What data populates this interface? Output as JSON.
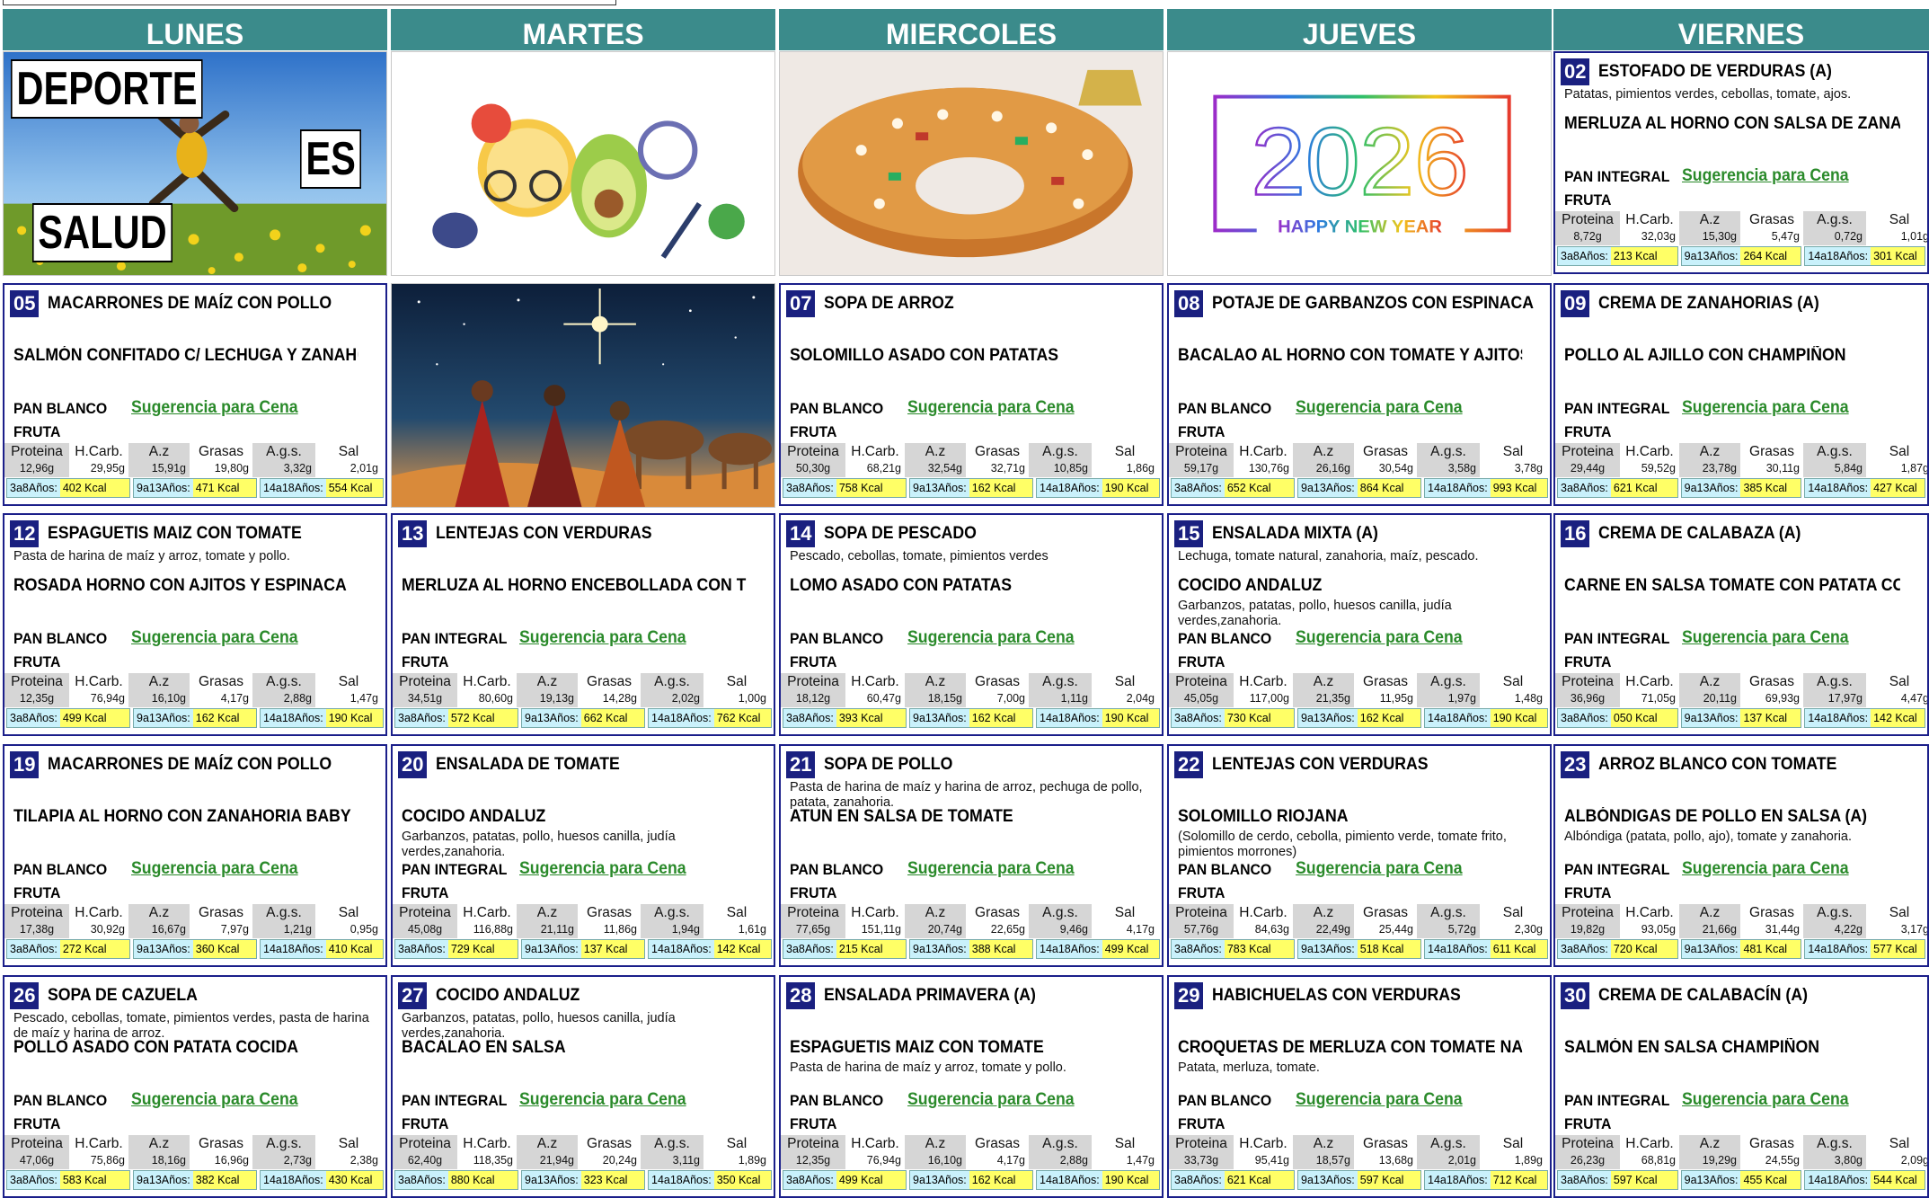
{
  "days": [
    "LUNES",
    "MARTES",
    "MIERCOLES",
    "JUEVES",
    "VIERNES"
  ],
  "image_cells": {
    "deporte": {
      "line1": "DEPORTE",
      "line2": "ES",
      "line3": "SALUD"
    },
    "newyear": {
      "year": "2026",
      "caption": "HAPPY NEW YEAR"
    }
  },
  "labels": {
    "sugerencia": "Sugerencia para Cena",
    "fruta": "FRUTA",
    "nutrients": [
      "Proteina",
      "H.Carb.",
      "A.z",
      "Grasas",
      "A.g.s.",
      "Sal"
    ],
    "age_groups": [
      "3a8Años:",
      "9a13Años:",
      "14a18Años:"
    ]
  },
  "cells": [
    {
      "day": "02",
      "dish1": "ESTOFADO DE VERDURAS (A)",
      "desc1": "Patatas, pimientos verdes, cebollas, tomate, ajos.",
      "dish2": "MERLUZA AL HORNO CON SALSA DE ZANAHO",
      "desc2": "",
      "bread": "PAN INTEGRAL",
      "nutrients": [
        "8,72g",
        "32,03g",
        "15,30g",
        "5,47g",
        "0,72g",
        "1,01g"
      ],
      "kcal": [
        "213 Kcal",
        "264 Kcal",
        "301 Kcal"
      ]
    },
    {
      "day": "05",
      "dish1": "MACARRONES DE MAÍZ CON POLLO",
      "desc1": "",
      "dish2": "SALMÓN CONFITADO C/ LECHUGA Y ZANAHO",
      "desc2": "",
      "bread": "PAN BLANCO",
      "nutrients": [
        "12,96g",
        "29,95g",
        "15,91g",
        "19,80g",
        "3,32g",
        "2,01g"
      ],
      "kcal": [
        "402 Kcal",
        "471 Kcal",
        "554 Kcal"
      ]
    },
    {
      "day": "07",
      "dish1": "SOPA DE ARROZ",
      "desc1": "",
      "dish2": "SOLOMILLO ASADO CON PATATAS",
      "desc2": "",
      "bread": "PAN BLANCO",
      "nutrients": [
        "50,30g",
        "68,21g",
        "32,54g",
        "32,71g",
        "10,85g",
        "1,86g"
      ],
      "kcal": [
        "758 Kcal",
        "162 Kcal",
        "190 Kcal"
      ]
    },
    {
      "day": "08",
      "dish1": "POTAJE DE GARBANZOS CON ESPINACA",
      "desc1": "",
      "dish2": "BACALAO AL HORNO CON TOMATE Y AJITOS",
      "desc2": "",
      "bread": "PAN BLANCO",
      "nutrients": [
        "59,17g",
        "130,76g",
        "26,16g",
        "30,54g",
        "3,58g",
        "3,78g"
      ],
      "kcal": [
        "652 Kcal",
        "864 Kcal",
        "993 Kcal"
      ]
    },
    {
      "day": "09",
      "dish1": "CREMA DE ZANAHORIAS (A)",
      "desc1": "",
      "dish2": "POLLO AL AJILLO CON CHAMPIÑON",
      "desc2": "",
      "bread": "PAN INTEGRAL",
      "nutrients": [
        "29,44g",
        "59,52g",
        "23,78g",
        "30,11g",
        "5,84g",
        "1,87g"
      ],
      "kcal": [
        "621 Kcal",
        "385 Kcal",
        "427 Kcal"
      ]
    },
    {
      "day": "12",
      "dish1": "ESPAGUETIS MAIZ CON TOMATE",
      "desc1": "Pasta de harina de maíz y arroz, tomate y pollo.",
      "dish2": "ROSADA HORNO CON AJITOS Y ESPINACA",
      "desc2": "",
      "bread": "PAN BLANCO",
      "nutrients": [
        "12,35g",
        "76,94g",
        "16,10g",
        "4,17g",
        "2,88g",
        "1,47g"
      ],
      "kcal": [
        "499 Kcal",
        "162 Kcal",
        "190 Kcal"
      ]
    },
    {
      "day": "13",
      "dish1": "LENTEJAS CON VERDURAS",
      "desc1": "",
      "dish2": "MERLUZA AL HORNO ENCEBOLLADA CON TO",
      "desc2": "",
      "bread": "PAN INTEGRAL",
      "nutrients": [
        "34,51g",
        "80,60g",
        "19,13g",
        "14,28g",
        "2,02g",
        "1,00g"
      ],
      "kcal": [
        "572 Kcal",
        "662 Kcal",
        "762 Kcal"
      ]
    },
    {
      "day": "14",
      "dish1": "SOPA DE PESCADO",
      "desc1": "Pescado, cebollas, tomate, pimientos verdes",
      "dish2": "LOMO ASADO CON PATATAS",
      "desc2": "",
      "bread": "PAN BLANCO",
      "nutrients": [
        "18,12g",
        "60,47g",
        "18,15g",
        "7,00g",
        "1,11g",
        "2,04g"
      ],
      "kcal": [
        "393 Kcal",
        "162 Kcal",
        "190 Kcal"
      ]
    },
    {
      "day": "15",
      "dish1": "ENSALADA MIXTA (A)",
      "desc1": "Lechuga, tomate natural, zanahoria, maíz, pescado.",
      "dish2": "COCIDO ANDALUZ",
      "desc2": "Garbanzos,  patatas, pollo,  huesos canilla, judía verdes,zanahoria.",
      "bread": "PAN BLANCO",
      "nutrients": [
        "45,05g",
        "117,00g",
        "21,35g",
        "11,95g",
        "1,97g",
        "1,48g"
      ],
      "kcal": [
        "730 Kcal",
        "162 Kcal",
        "190 Kcal"
      ]
    },
    {
      "day": "16",
      "dish1": "CREMA DE CALABAZA (A)",
      "desc1": "",
      "dish2": "CARNE EN SALSA TOMATE CON PATATA COCI",
      "desc2": "",
      "bread": "PAN INTEGRAL",
      "nutrients": [
        "36,96g",
        "71,05g",
        "20,11g",
        "69,93g",
        "17,97g",
        "4,47g"
      ],
      "kcal": [
        "050 Kcal",
        "137 Kcal",
        "142 Kcal"
      ]
    },
    {
      "day": "19",
      "dish1": "MACARRONES DE MAÍZ CON POLLO",
      "desc1": "",
      "dish2": "TILAPIA AL HORNO CON ZANAHORIA BABY",
      "desc2": "",
      "bread": "PAN BLANCO",
      "nutrients": [
        "17,38g",
        "30,92g",
        "16,67g",
        "7,97g",
        "1,21g",
        "0,95g"
      ],
      "kcal": [
        "272 Kcal",
        "360 Kcal",
        "410 Kcal"
      ]
    },
    {
      "day": "20",
      "dish1": "ENSALADA DE TOMATE",
      "desc1": "",
      "dish2": "COCIDO ANDALUZ",
      "desc2": "Garbanzos,  patatas, pollo,  huesos canilla, judía verdes,zanahoria.",
      "bread": "PAN INTEGRAL",
      "nutrients": [
        "45,08g",
        "116,88g",
        "21,11g",
        "11,86g",
        "1,94g",
        "1,61g"
      ],
      "kcal": [
        "729 Kcal",
        "137 Kcal",
        "142 Kcal"
      ]
    },
    {
      "day": "21",
      "dish1": "SOPA DE POLLO",
      "desc1": "Pasta de harina de maíz y harina de arroz, pechuga de pollo, patata, zanahoria.",
      "dish2": "ATUN EN SALSA DE TOMATE",
      "desc2": "",
      "bread": "PAN BLANCO",
      "nutrients": [
        "77,65g",
        "151,11g",
        "20,74g",
        "22,65g",
        "9,46g",
        "4,17g"
      ],
      "kcal": [
        "215 Kcal",
        "388 Kcal",
        "499 Kcal"
      ]
    },
    {
      "day": "22",
      "dish1": "LENTEJAS CON VERDURAS",
      "desc1": "",
      "dish2": "SOLOMILLO RIOJANA",
      "desc2": "(Solomillo de cerdo,  cebolla, pimiento verde, tomate frito, pimientos morrones)",
      "bread": "PAN BLANCO",
      "nutrients": [
        "57,76g",
        "84,63g",
        "22,49g",
        "25,44g",
        "5,72g",
        "2,30g"
      ],
      "kcal": [
        "783 Kcal",
        "518 Kcal",
        "611 Kcal"
      ]
    },
    {
      "day": "23",
      "dish1": "ARROZ BLANCO CON TOMATE",
      "desc1": "",
      "dish2": "ALBÓNDIGAS DE POLLO EN SALSA (A)",
      "desc2": "Albóndiga (patata, pollo, ajo), tomate y zanahoria.",
      "bread": "PAN INTEGRAL",
      "nutrients": [
        "19,82g",
        "93,05g",
        "21,66g",
        "31,44g",
        "4,22g",
        "3,17g"
      ],
      "kcal": [
        "720 Kcal",
        "481 Kcal",
        "577 Kcal"
      ]
    },
    {
      "day": "26",
      "dish1": "SOPA DE CAZUELA",
      "desc1": "Pescado, cebollas, tomate, pimientos verdes,  pasta de harina de maíz y harina de arroz.",
      "dish2": "POLLO ASADO CON PATATA COCIDA",
      "desc2": "",
      "bread": "PAN BLANCO",
      "nutrients": [
        "47,06g",
        "75,86g",
        "18,16g",
        "16,96g",
        "2,73g",
        "2,38g"
      ],
      "kcal": [
        "583 Kcal",
        "382 Kcal",
        "430 Kcal"
      ]
    },
    {
      "day": "27",
      "dish1": "COCIDO ANDALUZ",
      "desc1": "Garbanzos,  patatas, pollo,  huesos canilla, judía verdes,zanahoria.",
      "dish2": "BACALAO EN SALSA",
      "desc2": "",
      "bread": "PAN INTEGRAL",
      "nutrients": [
        "62,40g",
        "118,35g",
        "21,94g",
        "20,24g",
        "3,11g",
        "1,89g"
      ],
      "kcal": [
        "880 Kcal",
        "323 Kcal",
        "350 Kcal"
      ]
    },
    {
      "day": "28",
      "dish1": "ENSALADA PRIMAVERA (A)",
      "desc1": "",
      "dish2": "ESPAGUETIS MAIZ CON TOMATE",
      "desc2": "Pasta de harina de maíz y arroz, tomate y pollo.",
      "bread": "PAN BLANCO",
      "nutrients": [
        "12,35g",
        "76,94g",
        "16,10g",
        "4,17g",
        "2,88g",
        "1,47g"
      ],
      "kcal": [
        "499 Kcal",
        "162 Kcal",
        "190 Kcal"
      ]
    },
    {
      "day": "29",
      "dish1": "HABICHUELAS CON VERDURAS",
      "desc1": "",
      "dish2": "CROQUETAS DE MERLUZA CON TOMATE NAT",
      "desc2": "Patata, merluza, tomate.",
      "bread": "PAN BLANCO",
      "nutrients": [
        "33,73g",
        "95,41g",
        "18,57g",
        "13,68g",
        "2,01g",
        "1,89g"
      ],
      "kcal": [
        "621 Kcal",
        "597 Kcal",
        "712 Kcal"
      ]
    },
    {
      "day": "30",
      "dish1": "CREMA DE CALABACÍN (A)",
      "desc1": "",
      "dish2": "SALMÓN EN SALSA CHAMPIÑON",
      "desc2": "",
      "bread": "PAN INTEGRAL",
      "nutrients": [
        "26,23g",
        "68,81g",
        "19,29g",
        "24,55g",
        "3,80g",
        "2,09g"
      ],
      "kcal": [
        "597 Kcal",
        "455 Kcal",
        "544 Kcal"
      ]
    }
  ],
  "colors": {
    "header_bg": "#3b8b8b",
    "day_badge": "#1a2080",
    "suggestion": "#2a8a2a",
    "kcal_label_bg": "#c9f1fb",
    "kcal_value_bg": "#ffff66",
    "nutrient_shade": "#d6d6d6"
  }
}
